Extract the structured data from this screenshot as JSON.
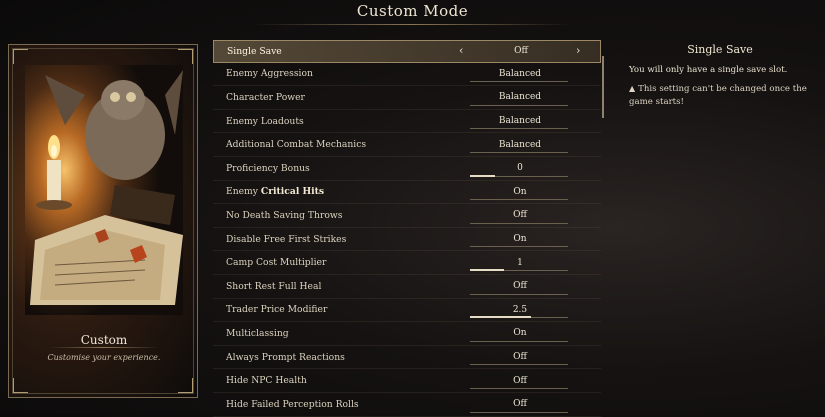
{
  "title": "Custom Mode",
  "card": {
    "title": "Custom",
    "subtitle": "Customise your experience."
  },
  "settings": [
    {
      "label": "Single Save",
      "value": "Off",
      "selected": true,
      "fill": 0
    },
    {
      "label": "Enemy Aggression",
      "value": "Balanced",
      "fill": 0
    },
    {
      "label": "Character Power",
      "value": "Balanced",
      "fill": 0
    },
    {
      "label": "Enemy Loadouts",
      "value": "Balanced",
      "fill": 0
    },
    {
      "label": "Additional Combat Mechanics",
      "value": "Balanced",
      "fill": 0
    },
    {
      "label": "Proficiency Bonus",
      "value": "0",
      "fill": 0.25
    },
    {
      "label_plain": "Enemy ",
      "label_bold": "Critical Hits",
      "value": "On",
      "fill": 0
    },
    {
      "label": "No Death Saving Throws",
      "value": "Off",
      "fill": 0
    },
    {
      "label": "Disable Free First Strikes",
      "value": "On",
      "fill": 0
    },
    {
      "label": "Camp Cost Multiplier",
      "value": "1",
      "fill": 0.35
    },
    {
      "label": "Short Rest Full Heal",
      "value": "Off",
      "fill": 0
    },
    {
      "label": "Trader Price Modifier",
      "value": "2.5",
      "fill": 0.62
    },
    {
      "label": "Multiclassing",
      "value": "On",
      "fill": 0
    },
    {
      "label": "Always Prompt Reactions",
      "value": "Off",
      "fill": 0
    },
    {
      "label": "Hide NPC Health",
      "value": "Off",
      "fill": 0
    },
    {
      "label": "Hide Failed Perception Rolls",
      "value": "Off",
      "fill": 0
    }
  ],
  "selector": {
    "left_arrow": "‹",
    "right_arrow": "›"
  },
  "info": {
    "title": "Single Save",
    "description": "You will only have a single save slot.",
    "warning_icon": "▲",
    "warning": "This setting can't be changed once the game starts!"
  },
  "colors": {
    "accent": "#9c8866",
    "text": "#e9e2d2",
    "background": "#151211"
  }
}
